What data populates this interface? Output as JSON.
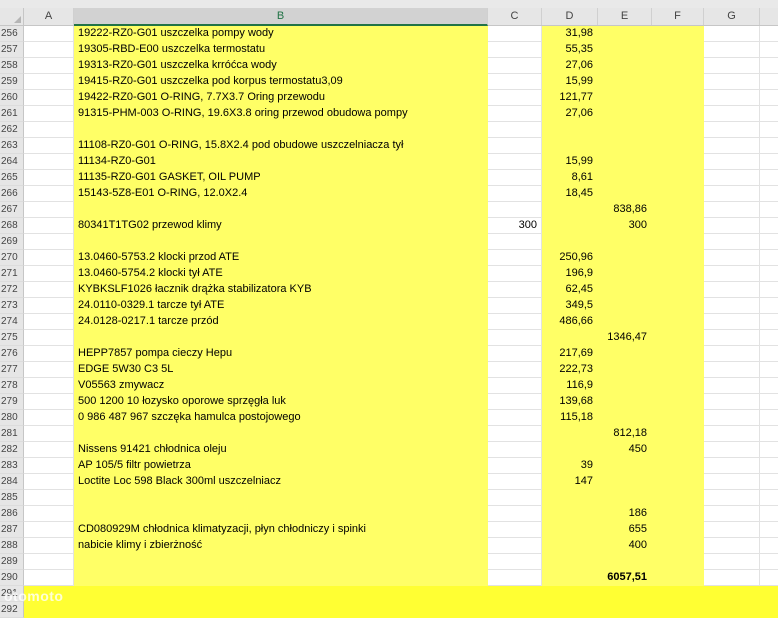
{
  "columns": [
    "A",
    "B",
    "C",
    "D",
    "E",
    "F",
    "G"
  ],
  "rows": [
    {
      "n": "256",
      "b": "19222-RZ0-G01   uszczelka pompy wody",
      "c": "",
      "d": "31,98",
      "e": ""
    },
    {
      "n": "257",
      "b": "19305-RBD-E00 uszczelka termostatu",
      "c": "",
      "d": "55,35",
      "e": ""
    },
    {
      "n": "258",
      "b": "19313-RZ0-G01 uszczelka krróćca wody",
      "c": "",
      "d": "27,06",
      "e": ""
    },
    {
      "n": "259",
      "b": "19415-RZ0-G01 uszczelka pod korpus termostatu3,09",
      "c": "",
      "d": "15,99",
      "e": ""
    },
    {
      "n": "260",
      "b": "19422-RZ0-G01 O-RING, 7.7X3.7   Oring przewodu",
      "c": "",
      "d": "121,77",
      "e": ""
    },
    {
      "n": "261",
      "b": "91315-PHM-003   O-RING, 19.6X3.8     oring przewod obudowa pompy",
      "c": "",
      "d": "27,06",
      "e": ""
    },
    {
      "n": "262",
      "b": "",
      "c": "",
      "d": "",
      "e": ""
    },
    {
      "n": "263",
      "b": "11108-RZ0-G01 O-RING, 15.8X2.4  pod obudowe uszczelniacza tył",
      "c": "",
      "d": "",
      "e": ""
    },
    {
      "n": "264",
      "b": "11134-RZ0-G01",
      "c": "",
      "d": "15,99",
      "e": ""
    },
    {
      "n": "265",
      "b": "11135-RZ0-G01  GASKET, OIL PUMP",
      "c": "",
      "d": "8,61",
      "e": ""
    },
    {
      "n": "266",
      "b": "15143-5Z8-E01  O-RING, 12.0X2.4",
      "c": "",
      "d": "18,45",
      "e": ""
    },
    {
      "n": "267",
      "b": "",
      "c": "",
      "d": "",
      "e": "838,86"
    },
    {
      "n": "268",
      "b": "80341T1TG02 przewod klimy",
      "c": "300",
      "d": "",
      "e": "300"
    },
    {
      "n": "269",
      "b": "",
      "c": "",
      "d": "",
      "e": ""
    },
    {
      "n": "270",
      "b": "13.0460-5753.2 klocki przod ATE",
      "c": "",
      "d": "250,96",
      "e": ""
    },
    {
      "n": "271",
      "b": "13.0460-5754.2 klocki tył ATE",
      "c": "",
      "d": "196,9",
      "e": ""
    },
    {
      "n": "272",
      "b": "KYBKSLF1026  łacznik drążka stabilizatora KYB",
      "c": "",
      "d": "62,45",
      "e": ""
    },
    {
      "n": "273",
      "b": "24.0110-0329.1 tarcze tył ATE",
      "c": "",
      "d": "349,5",
      "e": ""
    },
    {
      "n": "274",
      "b": "24.0128-0217.1  tarcze przód",
      "c": "",
      "d": "486,66",
      "e": ""
    },
    {
      "n": "275",
      "b": "",
      "c": "",
      "d": "",
      "e": "1346,47"
    },
    {
      "n": "276",
      "b": "HEPP7857 pompa cieczy Hepu",
      "c": "",
      "d": "217,69",
      "e": ""
    },
    {
      "n": "277",
      "b": "EDGE 5W30 C3 5L",
      "c": "",
      "d": "222,73",
      "e": ""
    },
    {
      "n": "278",
      "b": "V05563 zmywacz",
      "c": "",
      "d": "116,9",
      "e": ""
    },
    {
      "n": "279",
      "b": " 500 1200 10   łozysko oporowe sprzęgła luk",
      "c": "",
      "d": "139,68",
      "e": ""
    },
    {
      "n": "280",
      "b": "0 986 487 967 szczęka hamulca postojowego",
      "c": "",
      "d": "115,18",
      "e": ""
    },
    {
      "n": "281",
      "b": "",
      "c": "",
      "d": "",
      "e": "812,18"
    },
    {
      "n": "282",
      "b": "Nissens 91421 chłodnica oleju",
      "c": "",
      "d": "",
      "e": "450"
    },
    {
      "n": "283",
      "b": "AP 105/5 filtr powietrza",
      "c": "",
      "d": "39",
      "e": ""
    },
    {
      "n": "284",
      "b": "Loctite Loc 598 Black 300ml  uszczelniacz",
      "c": "",
      "d": "147",
      "e": ""
    },
    {
      "n": "285",
      "b": "",
      "c": "",
      "d": "",
      "e": ""
    },
    {
      "n": "286",
      "b": "",
      "c": "",
      "d": "",
      "e": "186"
    },
    {
      "n": "287",
      "b": "CD080929M  chłodnica klimatyzacji, płyn chłodniczy i spinki",
      "c": "",
      "d": "",
      "e": "655"
    },
    {
      "n": "288",
      "b": "nabicie klimy i zbierżność",
      "c": "",
      "d": "",
      "e": "400"
    },
    {
      "n": "289",
      "b": "",
      "c": "",
      "d": "",
      "e": ""
    },
    {
      "n": "290",
      "b": "",
      "c": "",
      "d": "",
      "e": "6057,51",
      "bold": true
    },
    {
      "n": "291",
      "b": "",
      "c": "",
      "d": "",
      "e": ""
    },
    {
      "n": "292",
      "b": "",
      "c": "",
      "d": "",
      "e": ""
    }
  ],
  "watermark": "otomoto"
}
